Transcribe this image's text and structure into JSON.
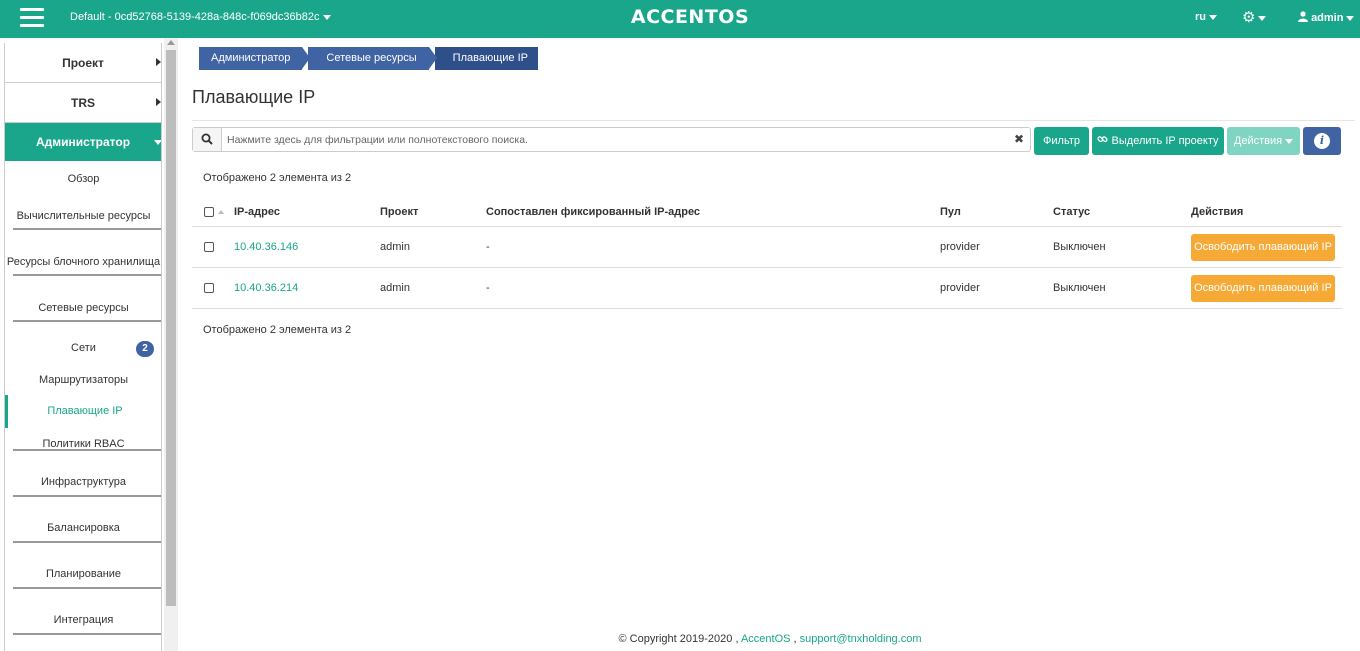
{
  "header": {
    "project_selector": "Default - 0cd52768-5139-428a-848c-f069dc36b82c",
    "logo": "ACCENTOS",
    "language": "ru",
    "user": "admin"
  },
  "sidebar": {
    "top_items": [
      "Проект",
      "TRS"
    ],
    "admin_label": "Администратор",
    "items": {
      "overview": "Обзор",
      "compute": "Вычислительные ресурсы",
      "block_storage": "Ресурсы блочного хранилища",
      "network": "Сетевые ресурсы",
      "networks": "Сети",
      "networks_badge": "2",
      "routers": "Маршрутизаторы",
      "floating_ips": "Плавающие IP",
      "rbac": "Политики RBAC",
      "infrastructure": "Инфраструктура",
      "balancing": "Балансировка",
      "scheduling": "Планирование",
      "integration": "Интеграция"
    }
  },
  "breadcrumb": [
    "Администратор",
    "Сетевые ресурсы",
    "Плавающие IP"
  ],
  "page": {
    "title": "Плавающие IP",
    "search_placeholder": "Нажмите здесь для фильтрации или полнотекстового поиска.",
    "filter_button": "Фильтр",
    "allocate_button": "Выделить IP проекту",
    "actions_button": "Действия",
    "count_text": "Отображено 2 элемента из 2"
  },
  "table": {
    "columns": [
      "IP-адрес",
      "Проект",
      "Сопоставлен фиксированный IP-адрес",
      "Пул",
      "Статус",
      "Действия"
    ],
    "rows": [
      {
        "ip": "10.40.36.146",
        "project": "admin",
        "fixed_ip": "-",
        "pool": "provider",
        "status": "Выключен",
        "action": "Освободить плавающий IP"
      },
      {
        "ip": "10.40.36.214",
        "project": "admin",
        "fixed_ip": "-",
        "pool": "provider",
        "status": "Выключен",
        "action": "Освободить плавающий IP"
      }
    ]
  },
  "footer": {
    "copyright": "© Copyright 2019-2020 ,",
    "product_link": "AccentOS",
    "separator": ",",
    "support_link": "support@tnxholding.com"
  },
  "colors": {
    "brand": "#1aa68a",
    "breadcrumb": "#3f63a3",
    "release_button": "#f7a935"
  },
  "icons": [
    "hamburger-icon",
    "gear-icon",
    "user-icon",
    "search-icon",
    "clear-icon",
    "link-icon",
    "info-icon"
  ]
}
